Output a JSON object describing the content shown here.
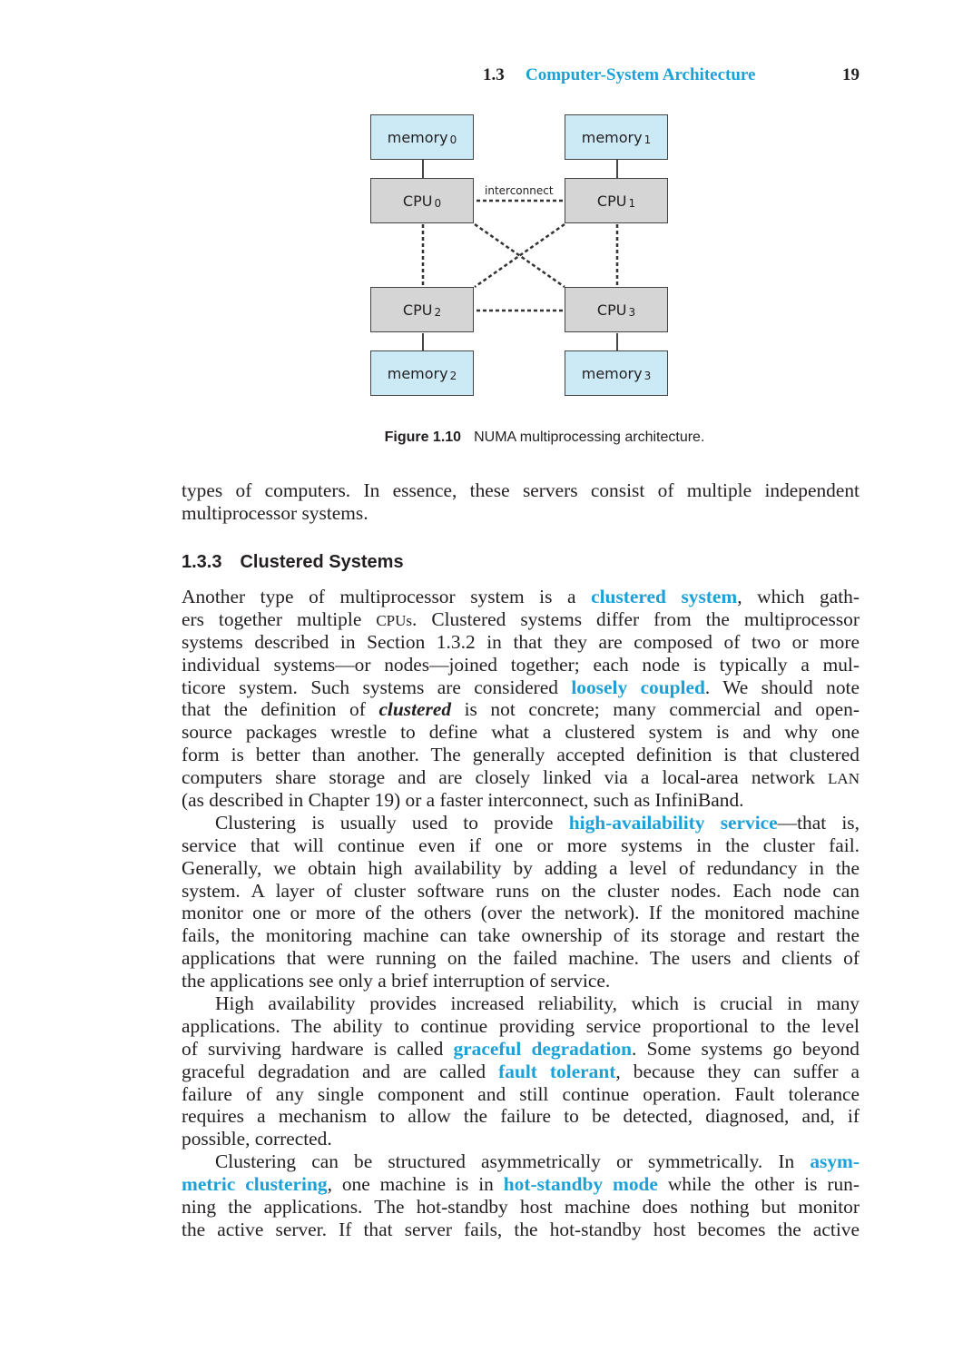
{
  "running_head": {
    "section_number": "1.3",
    "section_title": "Computer-System Architecture",
    "page_number": "19"
  },
  "figure": {
    "nodes": [
      {
        "type": "memory",
        "label": "memory",
        "sub": "0"
      },
      {
        "type": "memory",
        "label": "memory",
        "sub": "1"
      },
      {
        "type": "cpu",
        "label": "CPU",
        "sub": "0"
      },
      {
        "type": "cpu",
        "label": "CPU",
        "sub": "1"
      },
      {
        "type": "cpu",
        "label": "CPU",
        "sub": "2"
      },
      {
        "type": "cpu",
        "label": "CPU",
        "sub": "3"
      },
      {
        "type": "memory",
        "label": "memory",
        "sub": "2"
      },
      {
        "type": "memory",
        "label": "memory",
        "sub": "3"
      }
    ],
    "interconnect_label": "interconnect",
    "caption_label": "Figure 1.10",
    "caption_text": "NUMA multiprocessing architecture.",
    "colors": {
      "memory": "#cce9f6",
      "cpu": "#d5d5d6"
    }
  },
  "intro_lines": [
    "types of computers. In essence, these servers consist of multiple independent",
    "multiprocessor systems."
  ],
  "section": {
    "number": "1.3.3",
    "title": "Clustered Systems"
  },
  "terms": {
    "clustered_system": "clustered system",
    "loosely_coupled": "loosely coupled",
    "clustered_italic": "clustered",
    "high_availability": "high-availability service",
    "graceful_degradation": "graceful degradation",
    "fault_tolerant": "fault tolerant",
    "asym_part1": "asym-",
    "asym_part2": "metric clustering",
    "hot_standby": "hot-standby mode",
    "cpus": "CPUs",
    "lan": "LAN"
  },
  "para1": {
    "l1a": "Another type of multiprocessor system is a ",
    "l1b": ", which gath-",
    "l2a": "ers together multiple ",
    "l2b": ". Clustered systems differ from the multiprocessor",
    "l3": "systems described in Section 1.3.2 in that they are composed of two or more",
    "l4": "individual systems—or nodes—joined together; each node is typically a mul-",
    "l5a": "ticore system. Such systems are considered ",
    "l5b": ". We should note",
    "l6a": "that the definition of ",
    "l6b": " is not concrete; many commercial and open-",
    "l7": "source packages wrestle to define what a clustered system is and why one",
    "l8": "form is better than another. The generally accepted definition is that clustered",
    "l9": "computers share storage and are closely linked via a local-area network ",
    "l10": "(as described in Chapter 19) or a faster interconnect, such as InfiniBand."
  },
  "para2": {
    "l1a": "Clustering is usually used to provide ",
    "l1b": "—that is,",
    "l2": "service that will continue even if one or more systems in the cluster fail.",
    "l3": "Generally, we obtain high availability by adding a level of redundancy in the",
    "l4": "system. A layer of cluster software runs on the cluster nodes. Each node can",
    "l5": "monitor one or more of the others (over the network). If the monitored machine",
    "l6": "fails, the monitoring machine can take ownership of its storage and restart the",
    "l7": "applications that were running on the failed machine. The users and clients of",
    "l8": "the applications see only a brief interruption of service."
  },
  "para3": {
    "l1": "High availability provides increased reliability, which is crucial in many",
    "l2": "applications. The ability to continue providing service proportional to the level",
    "l3a": "of surviving hardware is called ",
    "l3b": ". Some systems go beyond",
    "l4a": "graceful degradation and are called ",
    "l4b": ", because they can suffer a",
    "l5": "failure of any single component and still continue operation. Fault tolerance",
    "l6": "requires a mechanism to allow the failure to be detected, diagnosed, and, if",
    "l7": "possible, corrected."
  },
  "para4": {
    "l1a": "Clustering can be structured asymmetrically or symmetrically. In ",
    "l2b": ", one machine is in ",
    "l2c": " while the other is run-",
    "l3": "ning the applications. The hot-standby host machine does nothing but monitor",
    "l4": "the active server. If that server fails, the hot-standby host becomes the active"
  }
}
